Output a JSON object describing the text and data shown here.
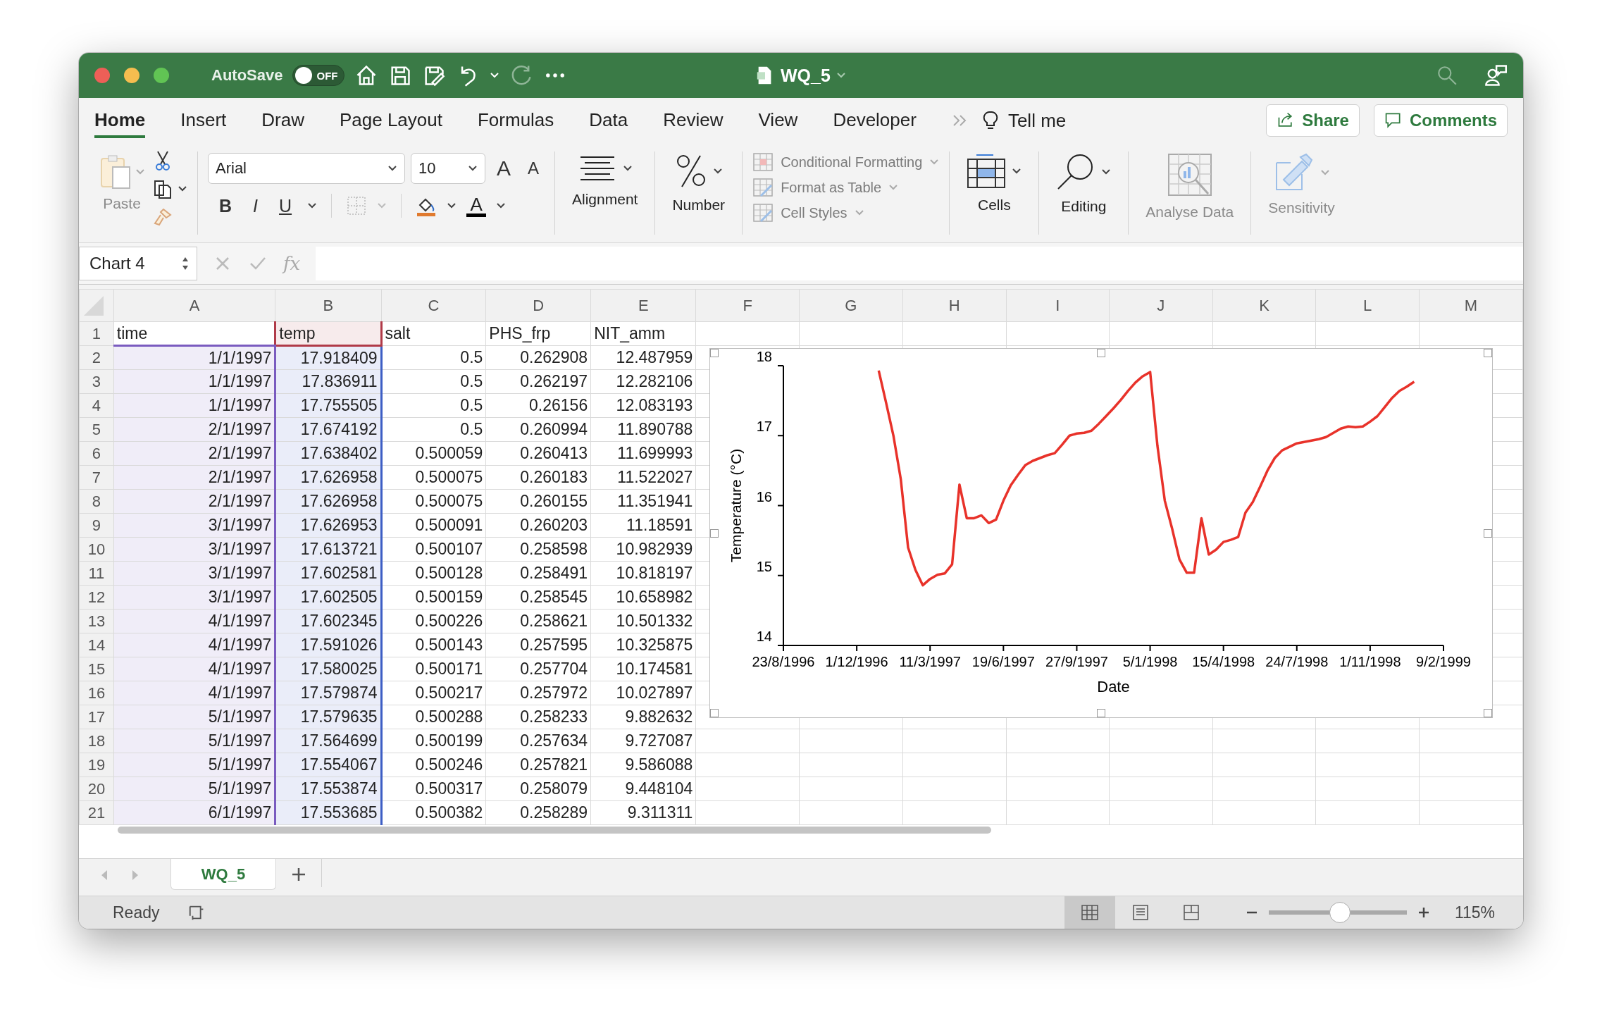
{
  "window": {
    "title": "WQ_5",
    "autosave": {
      "label": "AutoSave",
      "on": false,
      "state_text": "OFF"
    }
  },
  "tabs": [
    {
      "label": "Home",
      "selected": true
    },
    {
      "label": "Insert",
      "selected": false
    },
    {
      "label": "Draw",
      "selected": false
    },
    {
      "label": "Page Layout",
      "selected": false
    },
    {
      "label": "Formulas",
      "selected": false
    },
    {
      "label": "Data",
      "selected": false
    },
    {
      "label": "Review",
      "selected": false
    },
    {
      "label": "View",
      "selected": false
    },
    {
      "label": "Developer",
      "selected": false
    }
  ],
  "tell_me": "Tell me",
  "actions": [
    {
      "kind": "share",
      "label": "Share"
    },
    {
      "kind": "comments",
      "label": "Comments"
    }
  ],
  "ribbon": {
    "paste": {
      "label": "Paste",
      "disabled": true
    },
    "font": {
      "name": "Arial",
      "size": "10",
      "grow": "A",
      "shrink": "A",
      "bold": "B",
      "italic": "I",
      "underline": "U",
      "font_color": "A"
    },
    "groups": [
      {
        "kind": "alignment",
        "label": "Alignment",
        "disabled": false
      },
      {
        "kind": "number",
        "label": "Number",
        "disabled": false
      },
      {
        "kind": "styles",
        "items": [
          "Conditional Formatting",
          "Format as Table",
          "Cell Styles"
        ],
        "disabled": true
      },
      {
        "kind": "cells",
        "label": "Cells",
        "disabled": false
      },
      {
        "kind": "editing",
        "label": "Editing",
        "disabled": false
      },
      {
        "kind": "analyse",
        "label": "Analyse Data",
        "disabled": true
      },
      {
        "kind": "sensitivity",
        "label": "Sensitivity",
        "disabled": true
      }
    ]
  },
  "formula_bar": {
    "name_box": "Chart 4",
    "fx": "fx"
  },
  "grid": {
    "columns": [
      {
        "label": "A",
        "color": "#7a5bbf"
      },
      {
        "label": "B",
        "color": "#3d5ec4",
        "header": {
          "color": "#b03a48"
        }
      },
      {
        "label": "C"
      },
      {
        "label": "D"
      },
      {
        "label": "E"
      },
      {
        "label": "F"
      },
      {
        "label": "G"
      },
      {
        "label": "H"
      },
      {
        "label": "I"
      },
      {
        "label": "J"
      },
      {
        "label": "K"
      },
      {
        "label": "L"
      },
      {
        "label": "M"
      }
    ],
    "rows": [
      {
        "number": "1",
        "cells": [
          "time",
          "temp",
          "salt",
          "PHS_frp",
          "NIT_amm"
        ]
      },
      {
        "number": "2",
        "cells": [
          "1/1/1997",
          "17.918409",
          "0.5",
          "0.262908",
          "12.487959"
        ]
      },
      {
        "number": "3",
        "cells": [
          "1/1/1997",
          "17.836911",
          "0.5",
          "0.262197",
          "12.282106"
        ]
      },
      {
        "number": "4",
        "cells": [
          "1/1/1997",
          "17.755505",
          "0.5",
          "0.26156",
          "12.083193"
        ]
      },
      {
        "number": "5",
        "cells": [
          "2/1/1997",
          "17.674192",
          "0.5",
          "0.260994",
          "11.890788"
        ]
      },
      {
        "number": "6",
        "cells": [
          "2/1/1997",
          "17.638402",
          "0.500059",
          "0.260413",
          "11.699993"
        ]
      },
      {
        "number": "7",
        "cells": [
          "2/1/1997",
          "17.626958",
          "0.500075",
          "0.260183",
          "11.522027"
        ]
      },
      {
        "number": "8",
        "cells": [
          "2/1/1997",
          "17.626958",
          "0.500075",
          "0.260155",
          "11.351941"
        ]
      },
      {
        "number": "9",
        "cells": [
          "3/1/1997",
          "17.626953",
          "0.500091",
          "0.260203",
          "11.18591"
        ]
      },
      {
        "number": "10",
        "cells": [
          "3/1/1997",
          "17.613721",
          "0.500107",
          "0.258598",
          "10.982939"
        ]
      },
      {
        "number": "11",
        "cells": [
          "3/1/1997",
          "17.602581",
          "0.500128",
          "0.258491",
          "10.818197"
        ]
      },
      {
        "number": "12",
        "cells": [
          "3/1/1997",
          "17.602505",
          "0.500159",
          "0.258545",
          "10.658982"
        ]
      },
      {
        "number": "13",
        "cells": [
          "4/1/1997",
          "17.602345",
          "0.500226",
          "0.258621",
          "10.501332"
        ]
      },
      {
        "number": "14",
        "cells": [
          "4/1/1997",
          "17.591026",
          "0.500143",
          "0.257595",
          "10.325875"
        ]
      },
      {
        "number": "15",
        "cells": [
          "4/1/1997",
          "17.580025",
          "0.500171",
          "0.257704",
          "10.174581"
        ]
      },
      {
        "number": "16",
        "cells": [
          "4/1/1997",
          "17.579874",
          "0.500217",
          "0.257972",
          "10.027897"
        ]
      },
      {
        "number": "17",
        "cells": [
          "5/1/1997",
          "17.579635",
          "0.500288",
          "0.258233",
          "9.882632"
        ]
      },
      {
        "number": "18",
        "cells": [
          "5/1/1997",
          "17.564699",
          "0.500199",
          "0.257634",
          "9.727087"
        ]
      },
      {
        "number": "19",
        "cells": [
          "5/1/1997",
          "17.554067",
          "0.500246",
          "0.257821",
          "9.586088"
        ]
      },
      {
        "number": "20",
        "cells": [
          "5/1/1997",
          "17.553874",
          "0.500317",
          "0.258079",
          "9.448104"
        ]
      },
      {
        "number": "21",
        "cells": [
          "6/1/1997",
          "17.553685",
          "0.500382",
          "0.258289",
          "9.311311"
        ]
      }
    ]
  },
  "chart": {
    "chart_data": {
      "type": "line",
      "xlabel": "Date",
      "ylabel": "Temperature (°C)",
      "categories": [
        "23/8/1996",
        null,
        null,
        null,
        null,
        null,
        null,
        null,
        null,
        null,
        "1/12/1996",
        null,
        null,
        null,
        null,
        null,
        null,
        null,
        null,
        null,
        "11/3/1997",
        null,
        null,
        null,
        null,
        null,
        null,
        null,
        null,
        null,
        "19/6/1997",
        null,
        null,
        null,
        null,
        null,
        null,
        null,
        null,
        null,
        "27/9/1997",
        null,
        null,
        null,
        null,
        null,
        null,
        null,
        null,
        null,
        "5/1/1998",
        null,
        null,
        null,
        null,
        null,
        null,
        null,
        null,
        null,
        "15/4/1998",
        null,
        null,
        null,
        null,
        null,
        null,
        null,
        null,
        null,
        "24/7/1998",
        null,
        null,
        null,
        null,
        null,
        null,
        null,
        null,
        null,
        "1/11/1998",
        null,
        null,
        null,
        null,
        null,
        null,
        null,
        null,
        null,
        "9/2/1999"
      ],
      "series": [
        {
          "color": "#e8322a",
          "values": [
            null,
            null,
            null,
            null,
            null,
            null,
            null,
            null,
            null,
            null,
            null,
            null,
            null,
            17.93,
            17.47,
            17.0,
            16.38,
            15.4,
            15.08,
            14.86,
            14.95,
            15.01,
            15.03,
            15.16,
            16.3,
            15.82,
            15.82,
            15.86,
            15.75,
            15.8,
            16.07,
            16.29,
            16.44,
            16.58,
            16.64,
            16.68,
            16.72,
            16.75,
            16.87,
            17.0,
            17.03,
            17.04,
            17.07,
            17.17,
            17.28,
            17.39,
            17.51,
            17.64,
            17.76,
            17.85,
            17.91,
            16.85,
            16.07,
            15.67,
            15.23,
            15.04,
            15.04,
            15.82,
            15.3,
            15.37,
            15.48,
            15.51,
            15.55,
            15.9,
            16.05,
            16.27,
            16.5,
            16.68,
            16.79,
            16.84,
            16.89,
            16.91,
            16.93,
            16.95,
            16.98,
            17.04,
            17.1,
            17.13,
            17.12,
            17.13,
            17.2,
            17.28,
            17.41,
            17.54,
            17.64,
            17.7,
            17.77,
            null,
            null,
            null,
            null
          ]
        }
      ],
      "ylim": [
        14,
        18
      ],
      "yticks": [
        14,
        15,
        16,
        17,
        18
      ]
    }
  },
  "sheet_tabs": [
    {
      "label": "WQ_5",
      "selected": true
    }
  ],
  "status_bar": {
    "status": "Ready",
    "views": [
      {
        "kind": "normal",
        "selected": true
      },
      {
        "kind": "page_layout",
        "selected": false
      },
      {
        "kind": "page_break",
        "selected": false
      }
    ],
    "zoom": {
      "level": 0.52,
      "reading": "115%"
    }
  }
}
